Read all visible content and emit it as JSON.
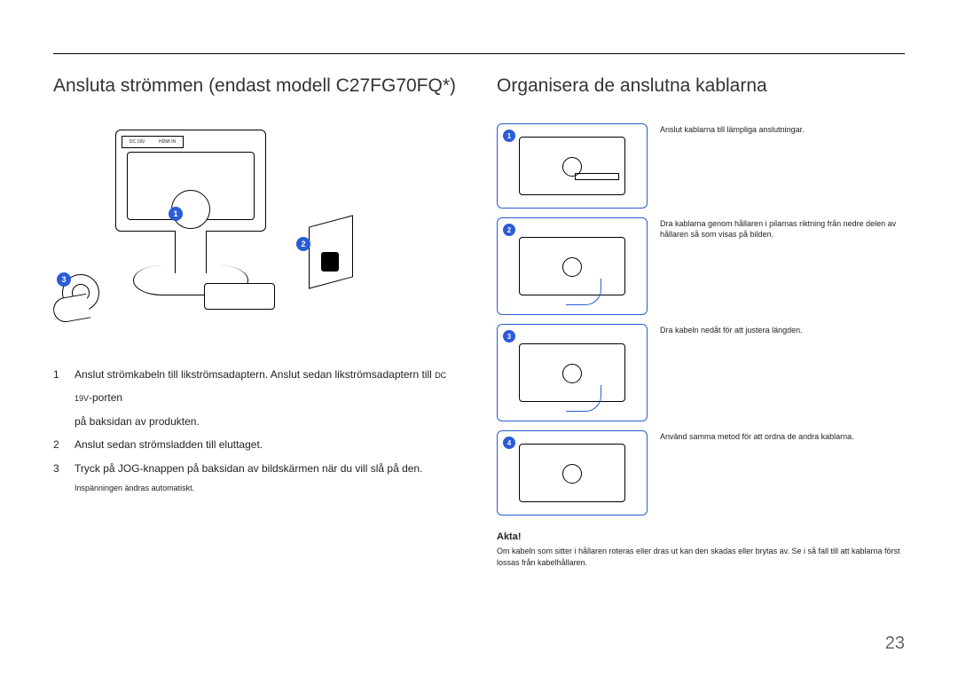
{
  "left": {
    "heading": "Ansluta strömmen (endast modell C27FG70FQ*)",
    "port_labels": {
      "dc": "DC 19V",
      "hdmi": "HDMI IN"
    },
    "callouts": {
      "n1": "1",
      "n2": "2",
      "n3": "3"
    },
    "steps": [
      {
        "num": "1",
        "text": "Anslut strömkabeln till likströmsadaptern. Anslut sedan likströmsadaptern till",
        "suffix_label": "DC 19V",
        "suffix_rest": "-porten",
        "line2": "på baksidan av produkten."
      },
      {
        "num": "2",
        "text": "Anslut sedan strömsladden till eluttaget."
      },
      {
        "num": "3",
        "text": "Tryck på JOG-knappen på baksidan av bildskärmen när du vill slå på den."
      }
    ],
    "footnote": "Inspänningen ändras automatiskt."
  },
  "right": {
    "heading": "Organisera de anslutna kablarna",
    "thumbs": [
      {
        "num": "1",
        "caption": "Anslut kablarna till lämpliga anslutningar."
      },
      {
        "num": "2",
        "caption": "Dra kablarna genom hållaren i pilarnas riktning från nedre delen av hållaren så som visas på bilden."
      },
      {
        "num": "3",
        "caption": "Dra kabeln nedåt för att justera längden."
      },
      {
        "num": "4",
        "caption": "Använd samma metod för att ordna de andra kablarna."
      }
    ],
    "note": {
      "title": "Akta!",
      "body": "Om kabeln som sitter i hållaren roteras eller dras ut kan den skadas eller brytas av. Se i så fall till att kablarna först lossas från kabelhållaren."
    }
  },
  "page_number": "23"
}
